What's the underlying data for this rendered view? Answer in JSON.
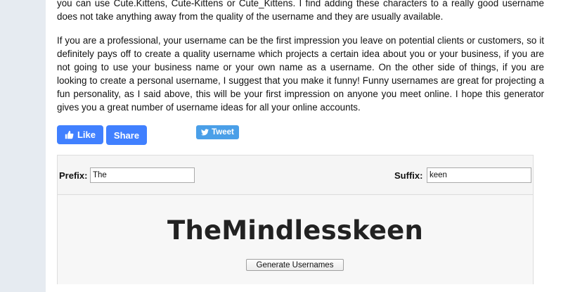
{
  "article": {
    "paragraph1": "you can use Cute.Kittens, Cute-Kittens or Cute_Kittens. I find adding these characters to a really good username does not take anything away from the quality of the username and they are usually available.",
    "paragraph2": "If you are a professional, your username can be the first impression you leave on potential clients or customers, so it definitely pays off to create a quality username which projects a certain idea about you or your business, if you are not going to use your business name or your own name as a username. On the other side of things, if you are looking to create a personal username, I suggest that you make it funny! Funny usernames are great for projecting a fun personality, as I said above, this will be your first impression on anyone you meet online. I hope this generator gives you a great number of username ideas for all your online accounts."
  },
  "social": {
    "like_label": "Like",
    "share_label": "Share",
    "tweet_label": "Tweet",
    "like_icon": "thumbs-up-icon",
    "tweet_icon": "twitter-bird-icon"
  },
  "generator": {
    "prefix_label": "Prefix:",
    "prefix_value": "The",
    "suffix_label": "Suffix:",
    "suffix_value": "keen",
    "result": "TheMindlesskeen",
    "generate_label": "Generate Usernames"
  },
  "colors": {
    "facebook_blue": "#4080ff",
    "twitter_blue": "#4a9fe8",
    "sidebar_bg": "#e6ebf1"
  }
}
